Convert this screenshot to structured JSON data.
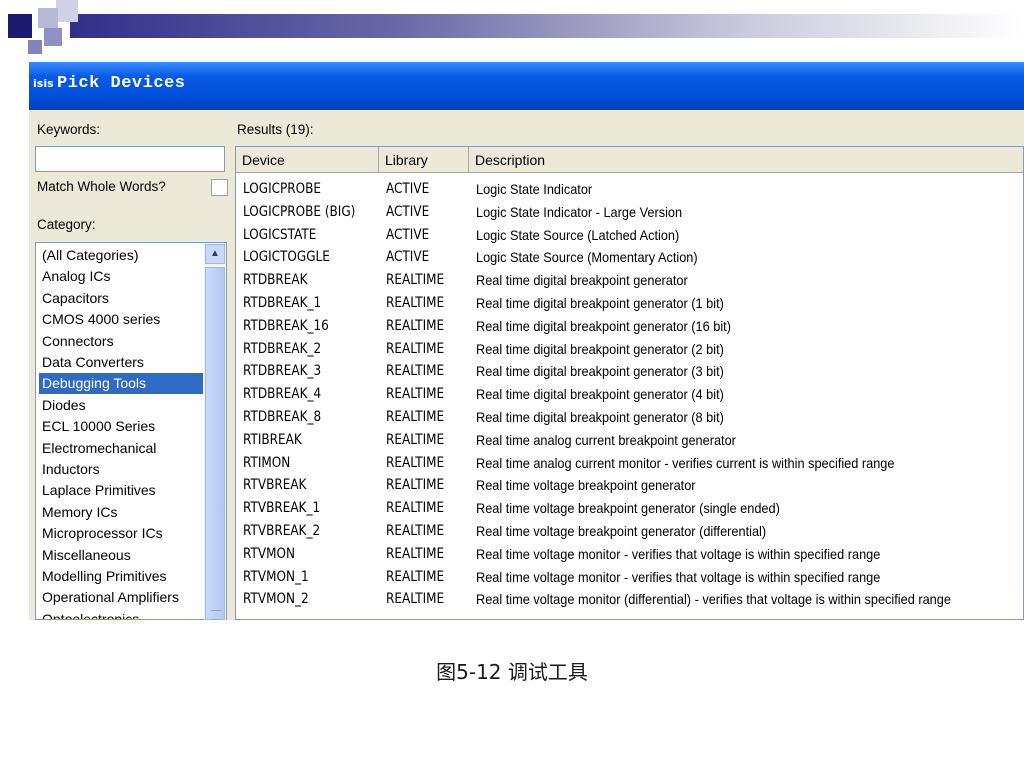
{
  "dialog": {
    "app_icon": "isis",
    "title": "Pick Devices",
    "keywords_label": "Keywords:",
    "keywords_value": "",
    "match_whole_words_label": "Match Whole Words?",
    "category_label": "Category:",
    "results_label": "Results (19):"
  },
  "categories": [
    "(All Categories)",
    "Analog ICs",
    "Capacitors",
    "CMOS 4000 series",
    "Connectors",
    "Data Converters",
    "Debugging Tools",
    "Diodes",
    "ECL 10000 Series",
    "Electromechanical",
    "Inductors",
    "Laplace Primitives",
    "Memory ICs",
    "Microprocessor ICs",
    "Miscellaneous",
    "Modelling Primitives",
    "Operational Amplifiers",
    "Optoelectronics"
  ],
  "selected_category": "Debugging Tools",
  "columns": [
    "Device",
    "Library",
    "Description"
  ],
  "rows": [
    [
      "LOGICPROBE",
      "ACTIVE",
      "Logic State Indicator"
    ],
    [
      "LOGICPROBE (BIG)",
      "ACTIVE",
      "Logic State Indicator - Large Version"
    ],
    [
      "LOGICSTATE",
      "ACTIVE",
      "Logic State Source (Latched Action)"
    ],
    [
      "LOGICTOGGLE",
      "ACTIVE",
      "Logic State Source (Momentary Action)"
    ],
    [
      "RTDBREAK",
      "REALTIME",
      "Real time digital breakpoint generator"
    ],
    [
      "RTDBREAK_1",
      "REALTIME",
      "Real time digital breakpoint generator (1 bit)"
    ],
    [
      "RTDBREAK_16",
      "REALTIME",
      "Real time digital breakpoint generator (16 bit)"
    ],
    [
      "RTDBREAK_2",
      "REALTIME",
      "Real time digital breakpoint generator (2 bit)"
    ],
    [
      "RTDBREAK_3",
      "REALTIME",
      "Real time digital breakpoint generator (3 bit)"
    ],
    [
      "RTDBREAK_4",
      "REALTIME",
      "Real time digital breakpoint generator (4 bit)"
    ],
    [
      "RTDBREAK_8",
      "REALTIME",
      "Real time digital breakpoint generator (8 bit)"
    ],
    [
      "RTIBREAK",
      "REALTIME",
      "Real time analog current breakpoint generator"
    ],
    [
      "RTIMON",
      "REALTIME",
      "Real time analog current monitor - verifies current is within specified range"
    ],
    [
      "RTVBREAK",
      "REALTIME",
      "Real time voltage breakpoint generator"
    ],
    [
      "RTVBREAK_1",
      "REALTIME",
      "Real time voltage breakpoint generator (single ended)"
    ],
    [
      "RTVBREAK_2",
      "REALTIME",
      "Real time voltage breakpoint generator (differential)"
    ],
    [
      "RTVMON",
      "REALTIME",
      "Real time voltage monitor - verifies that voltage is within specified range"
    ],
    [
      "RTVMON_1",
      "REALTIME",
      "Real time voltage monitor - verifies that voltage is within specified range"
    ],
    [
      "RTVMON_2",
      "REALTIME",
      "Real time voltage monitor (differential) - verifies that voltage is within specified range"
    ]
  ],
  "caption": "图5-12  调试工具",
  "colors": {
    "title_bar": "#0050dc",
    "selection": "#316ac5",
    "dialog_bg": "#ece9d8",
    "slide_accent": "#1a1a6e"
  }
}
